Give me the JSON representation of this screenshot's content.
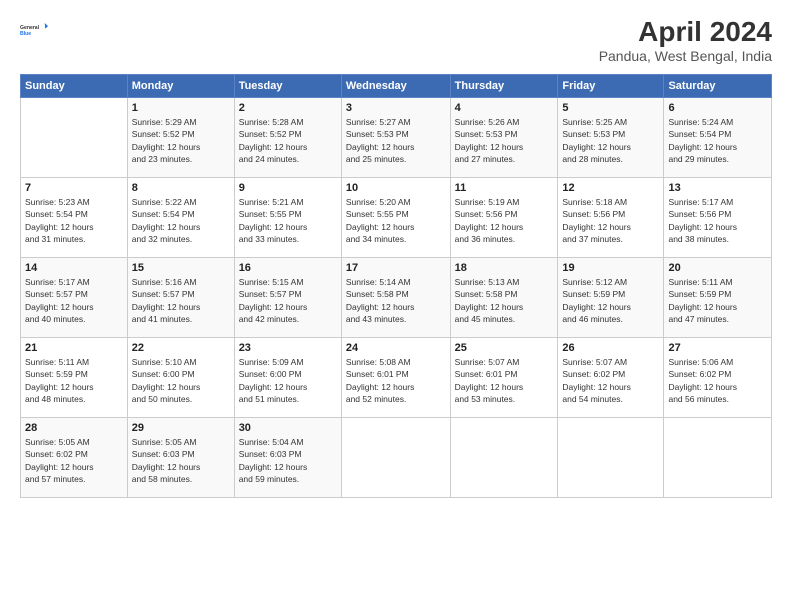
{
  "logo": {
    "general": "General",
    "blue": "Blue"
  },
  "title": "April 2024",
  "subtitle": "Pandua, West Bengal, India",
  "days_of_week": [
    "Sunday",
    "Monday",
    "Tuesday",
    "Wednesday",
    "Thursday",
    "Friday",
    "Saturday"
  ],
  "weeks": [
    [
      {
        "day": "",
        "info": ""
      },
      {
        "day": "1",
        "info": "Sunrise: 5:29 AM\nSunset: 5:52 PM\nDaylight: 12 hours\nand 23 minutes."
      },
      {
        "day": "2",
        "info": "Sunrise: 5:28 AM\nSunset: 5:52 PM\nDaylight: 12 hours\nand 24 minutes."
      },
      {
        "day": "3",
        "info": "Sunrise: 5:27 AM\nSunset: 5:53 PM\nDaylight: 12 hours\nand 25 minutes."
      },
      {
        "day": "4",
        "info": "Sunrise: 5:26 AM\nSunset: 5:53 PM\nDaylight: 12 hours\nand 27 minutes."
      },
      {
        "day": "5",
        "info": "Sunrise: 5:25 AM\nSunset: 5:53 PM\nDaylight: 12 hours\nand 28 minutes."
      },
      {
        "day": "6",
        "info": "Sunrise: 5:24 AM\nSunset: 5:54 PM\nDaylight: 12 hours\nand 29 minutes."
      }
    ],
    [
      {
        "day": "7",
        "info": "Sunrise: 5:23 AM\nSunset: 5:54 PM\nDaylight: 12 hours\nand 31 minutes."
      },
      {
        "day": "8",
        "info": "Sunrise: 5:22 AM\nSunset: 5:54 PM\nDaylight: 12 hours\nand 32 minutes."
      },
      {
        "day": "9",
        "info": "Sunrise: 5:21 AM\nSunset: 5:55 PM\nDaylight: 12 hours\nand 33 minutes."
      },
      {
        "day": "10",
        "info": "Sunrise: 5:20 AM\nSunset: 5:55 PM\nDaylight: 12 hours\nand 34 minutes."
      },
      {
        "day": "11",
        "info": "Sunrise: 5:19 AM\nSunset: 5:56 PM\nDaylight: 12 hours\nand 36 minutes."
      },
      {
        "day": "12",
        "info": "Sunrise: 5:18 AM\nSunset: 5:56 PM\nDaylight: 12 hours\nand 37 minutes."
      },
      {
        "day": "13",
        "info": "Sunrise: 5:17 AM\nSunset: 5:56 PM\nDaylight: 12 hours\nand 38 minutes."
      }
    ],
    [
      {
        "day": "14",
        "info": "Sunrise: 5:17 AM\nSunset: 5:57 PM\nDaylight: 12 hours\nand 40 minutes."
      },
      {
        "day": "15",
        "info": "Sunrise: 5:16 AM\nSunset: 5:57 PM\nDaylight: 12 hours\nand 41 minutes."
      },
      {
        "day": "16",
        "info": "Sunrise: 5:15 AM\nSunset: 5:57 PM\nDaylight: 12 hours\nand 42 minutes."
      },
      {
        "day": "17",
        "info": "Sunrise: 5:14 AM\nSunset: 5:58 PM\nDaylight: 12 hours\nand 43 minutes."
      },
      {
        "day": "18",
        "info": "Sunrise: 5:13 AM\nSunset: 5:58 PM\nDaylight: 12 hours\nand 45 minutes."
      },
      {
        "day": "19",
        "info": "Sunrise: 5:12 AM\nSunset: 5:59 PM\nDaylight: 12 hours\nand 46 minutes."
      },
      {
        "day": "20",
        "info": "Sunrise: 5:11 AM\nSunset: 5:59 PM\nDaylight: 12 hours\nand 47 minutes."
      }
    ],
    [
      {
        "day": "21",
        "info": "Sunrise: 5:11 AM\nSunset: 5:59 PM\nDaylight: 12 hours\nand 48 minutes."
      },
      {
        "day": "22",
        "info": "Sunrise: 5:10 AM\nSunset: 6:00 PM\nDaylight: 12 hours\nand 50 minutes."
      },
      {
        "day": "23",
        "info": "Sunrise: 5:09 AM\nSunset: 6:00 PM\nDaylight: 12 hours\nand 51 minutes."
      },
      {
        "day": "24",
        "info": "Sunrise: 5:08 AM\nSunset: 6:01 PM\nDaylight: 12 hours\nand 52 minutes."
      },
      {
        "day": "25",
        "info": "Sunrise: 5:07 AM\nSunset: 6:01 PM\nDaylight: 12 hours\nand 53 minutes."
      },
      {
        "day": "26",
        "info": "Sunrise: 5:07 AM\nSunset: 6:02 PM\nDaylight: 12 hours\nand 54 minutes."
      },
      {
        "day": "27",
        "info": "Sunrise: 5:06 AM\nSunset: 6:02 PM\nDaylight: 12 hours\nand 56 minutes."
      }
    ],
    [
      {
        "day": "28",
        "info": "Sunrise: 5:05 AM\nSunset: 6:02 PM\nDaylight: 12 hours\nand 57 minutes."
      },
      {
        "day": "29",
        "info": "Sunrise: 5:05 AM\nSunset: 6:03 PM\nDaylight: 12 hours\nand 58 minutes."
      },
      {
        "day": "30",
        "info": "Sunrise: 5:04 AM\nSunset: 6:03 PM\nDaylight: 12 hours\nand 59 minutes."
      },
      {
        "day": "",
        "info": ""
      },
      {
        "day": "",
        "info": ""
      },
      {
        "day": "",
        "info": ""
      },
      {
        "day": "",
        "info": ""
      }
    ]
  ]
}
